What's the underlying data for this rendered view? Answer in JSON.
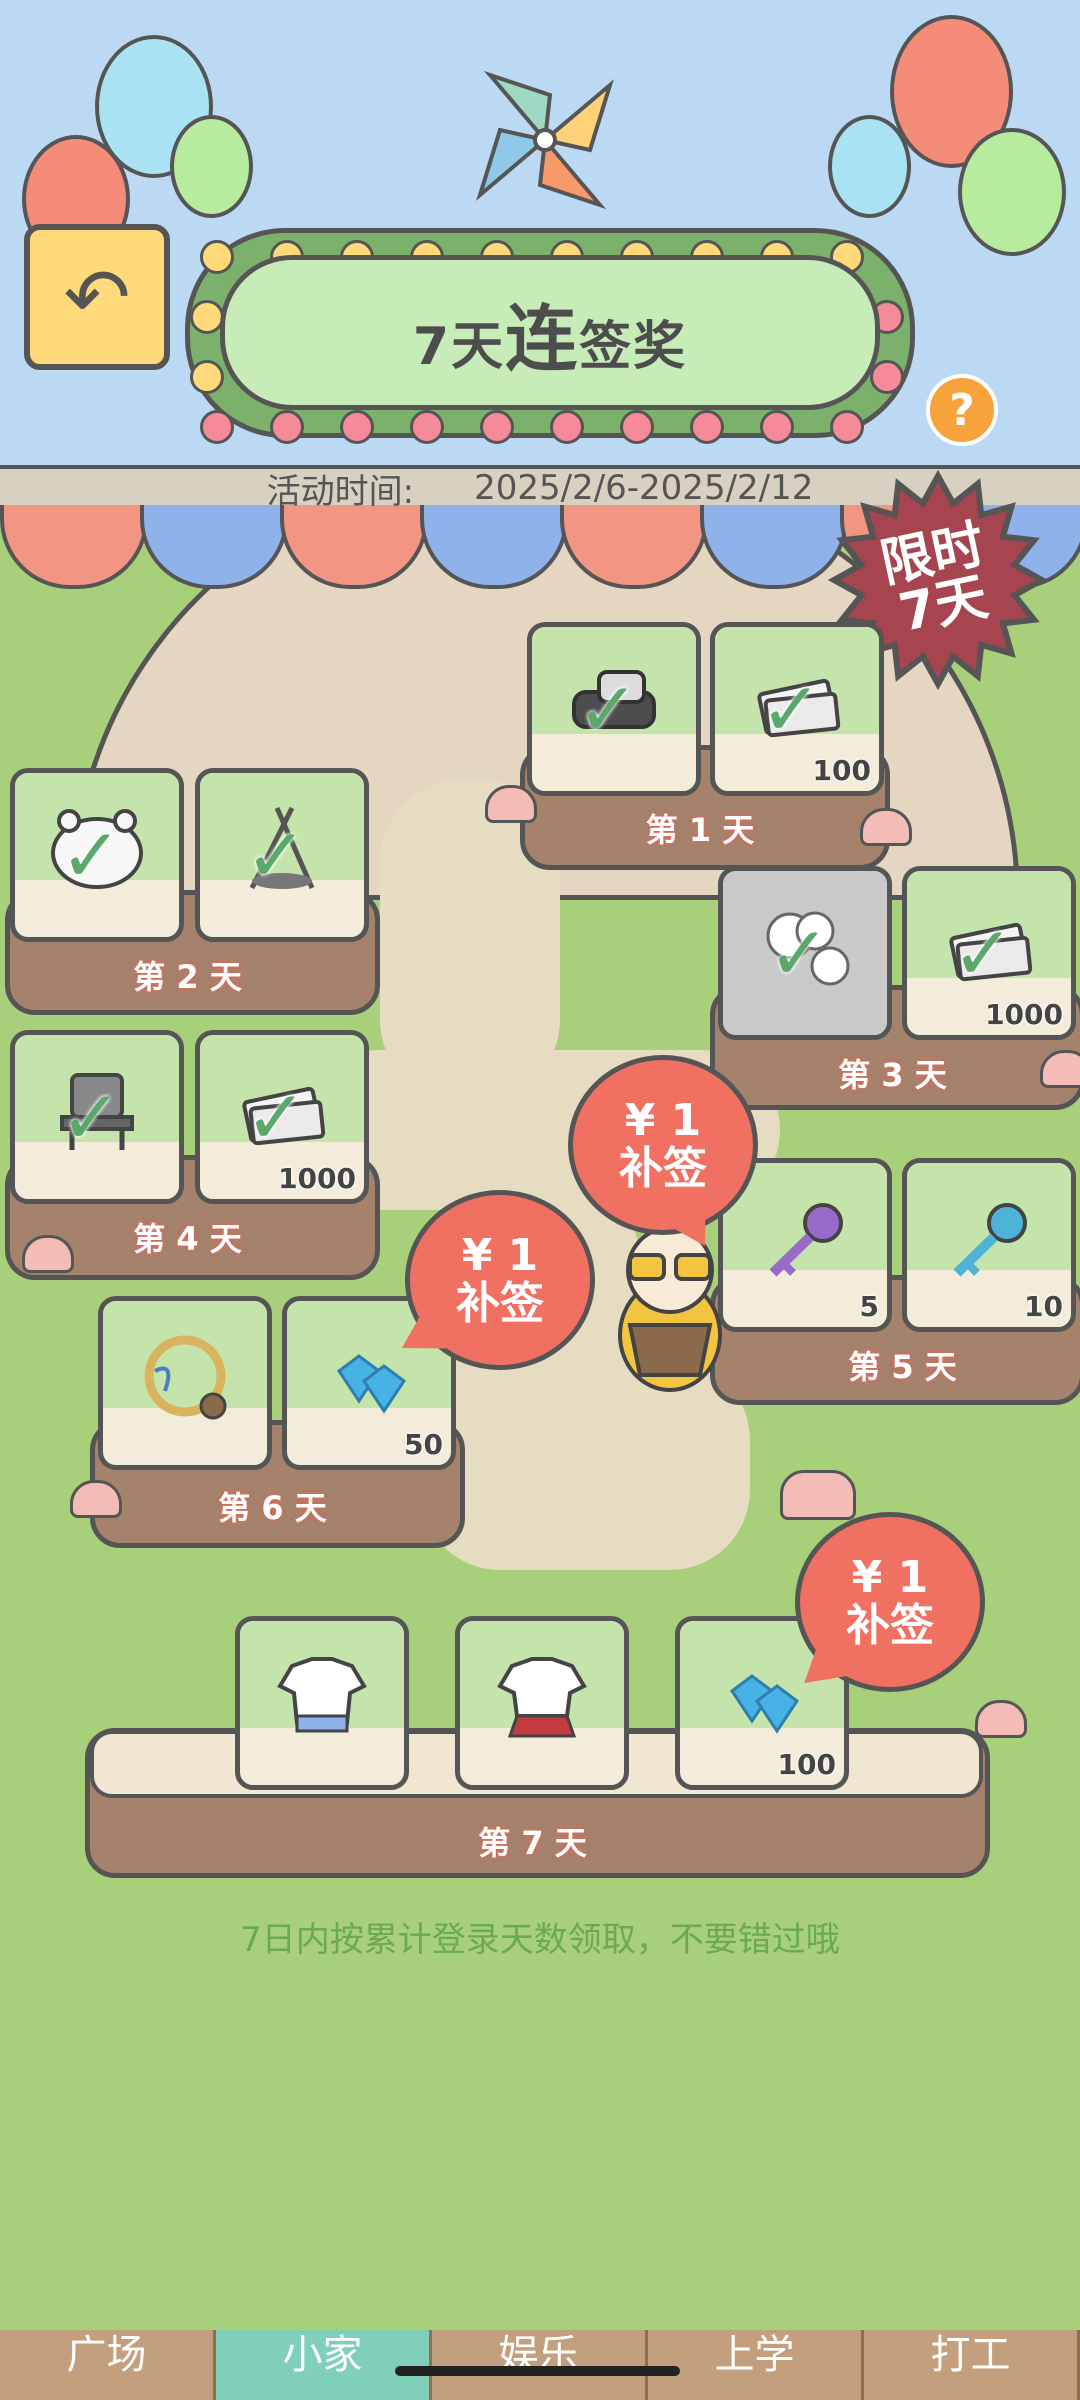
{
  "header": {
    "title_part1": "7天",
    "title_part2": "连",
    "title_part3": "签奖",
    "date_label": "活动时间:",
    "date_range": "2025/2/6-2025/2/12",
    "badge_line1": "限时",
    "badge_line2": "7天"
  },
  "days": [
    {
      "label": "第 1 天",
      "items": [
        {
          "icon": "shoes-icon",
          "qty": "",
          "claimed": true
        },
        {
          "icon": "cash-stack-icon",
          "qty": "100",
          "claimed": true
        }
      ]
    },
    {
      "label": "第 2 天",
      "items": [
        {
          "icon": "bear-pillow-icon",
          "qty": "",
          "claimed": true
        },
        {
          "icon": "campfire-icon",
          "qty": "",
          "claimed": true
        }
      ]
    },
    {
      "label": "第 3 天",
      "items": [
        {
          "icon": "cloud-wallpaper-icon",
          "qty": "",
          "claimed": true
        },
        {
          "icon": "cash-stack-icon",
          "qty": "1000",
          "claimed": true
        }
      ]
    },
    {
      "label": "第 4 天",
      "items": [
        {
          "icon": "tv-stand-icon",
          "qty": "",
          "claimed": true
        },
        {
          "icon": "cash-stack-icon",
          "qty": "1000",
          "claimed": true
        }
      ]
    },
    {
      "label": "第 5 天",
      "items": [
        {
          "icon": "purple-key-icon",
          "qty": "5",
          "claimed": false
        },
        {
          "icon": "blue-key-icon",
          "qty": "10",
          "claimed": false
        }
      ]
    },
    {
      "label": "第 6 天",
      "items": [
        {
          "icon": "wreath-frame-icon",
          "qty": "",
          "claimed": false
        },
        {
          "icon": "diamond-icon",
          "qty": "50",
          "claimed": false
        }
      ]
    },
    {
      "label": "第 7 天",
      "items": [
        {
          "icon": "blue-uniform-icon",
          "qty": "",
          "claimed": false
        },
        {
          "icon": "red-uniform-icon",
          "qty": "",
          "claimed": false
        },
        {
          "icon": "diamond-icon",
          "qty": "100",
          "claimed": false
        }
      ]
    }
  ],
  "makeup_bubble": {
    "price": "¥ 1",
    "label": "补签"
  },
  "check_mark": "✓",
  "back_arrow": "↶",
  "help_symbol": "?",
  "footer_note": "7日内按累计登录天数领取，不要错过哦",
  "bottom_nav": [
    "广场",
    "小家",
    "娱乐",
    "上学",
    "打工"
  ],
  "colors": {
    "grass": "#a8cf7a",
    "log": "#a5826b",
    "bubble": "#f07061",
    "check": "#5aa96b",
    "title_board": "#c7ecb7"
  }
}
